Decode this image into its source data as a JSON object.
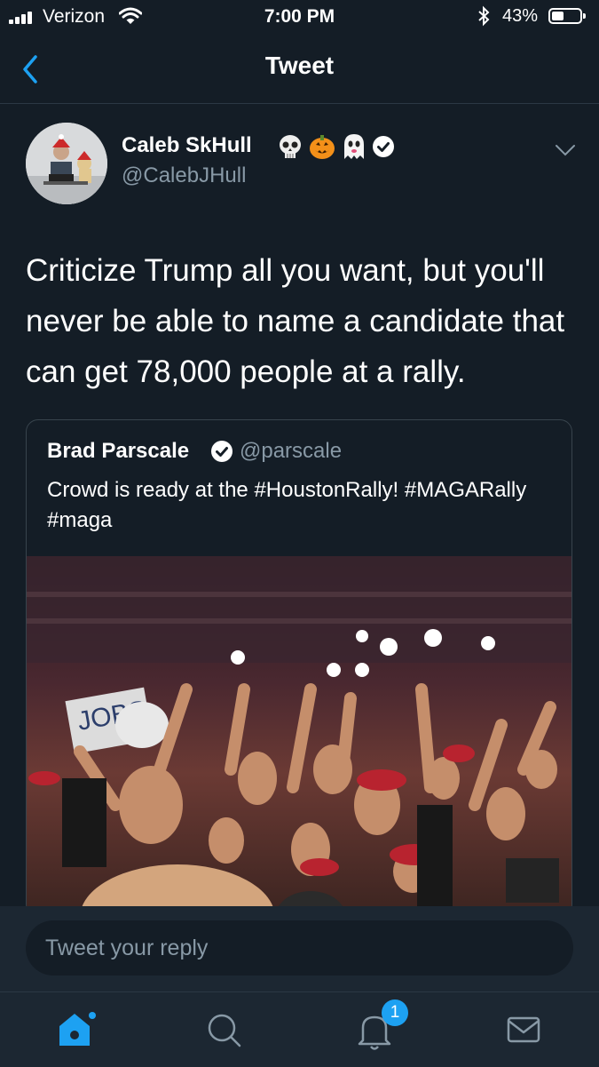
{
  "status_bar": {
    "carrier": "Verizon",
    "time": "7:00 PM",
    "battery_percent": "43%",
    "battery_level": 0.43
  },
  "nav": {
    "title": "Tweet"
  },
  "tweet": {
    "author_name": "Caleb SkHull",
    "author_handle": "@CalebJHull",
    "name_emojis": [
      "skull-emoji",
      "jack-o-lantern-emoji",
      "ghost-emoji"
    ],
    "text": "Criticize Trump all you want, but you'll never be able to name a candidate that can get 78,000 people at a rally."
  },
  "quoted_tweet": {
    "author_name": "Brad Parscale",
    "author_handle": "@parscale",
    "text": "Crowd is ready at the #HoustonRally! #MAGARally #maga",
    "media_sign_text": "JOBS"
  },
  "reply": {
    "placeholder": "Tweet your reply"
  },
  "tab_bar": {
    "notifications_badge": "1",
    "active_tab": "home"
  },
  "colors": {
    "background": "#141d26",
    "accent": "#1da1f2",
    "secondary_text": "#8899a6"
  }
}
